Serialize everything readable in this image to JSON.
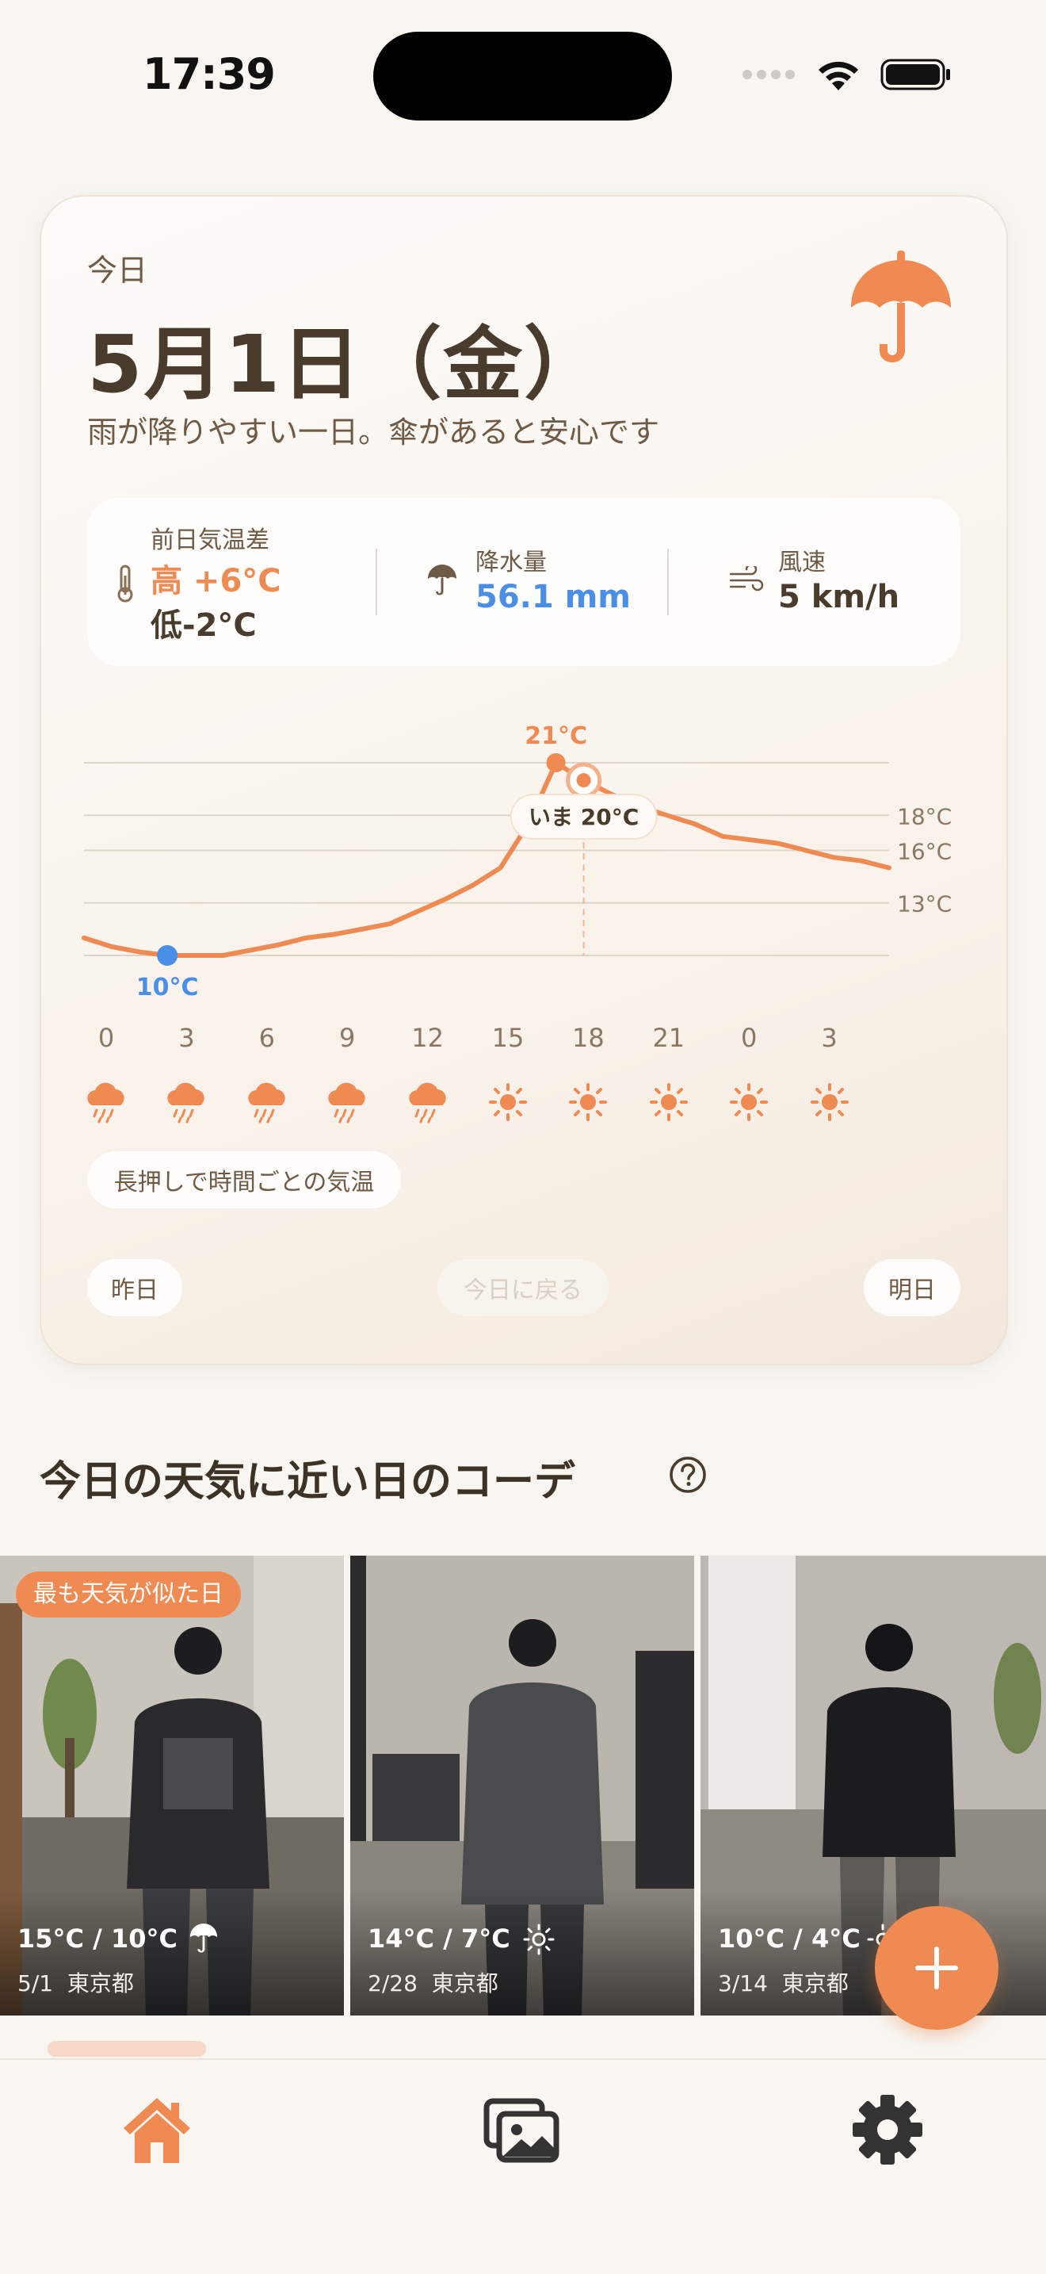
{
  "status_bar": {
    "time": "17:39"
  },
  "card": {
    "today_label": "今日",
    "date": "5月1日（金）",
    "description": "雨が降りやすい一日。傘があると安心です",
    "weather_icon": "umbrella-icon",
    "stats": {
      "diff_label": "前日気温差",
      "diff_high": "高 +6°C",
      "diff_low": "低-2°C",
      "precip_label": "降水量",
      "precip_value": "56.1 mm",
      "wind_label": "風速",
      "wind_value": "5 km/h"
    },
    "chart_data": {
      "type": "line",
      "x": [
        "0",
        "1",
        "2",
        "3",
        "4",
        "5",
        "6",
        "7",
        "8",
        "9",
        "10",
        "11",
        "12",
        "13",
        "14",
        "15",
        "16",
        "17",
        "18",
        "19",
        "20",
        "21",
        "22",
        "23",
        "0",
        "1",
        "2",
        "3",
        "4",
        "5"
      ],
      "values": [
        11,
        10.5,
        10.2,
        10,
        10,
        10,
        10.3,
        10.6,
        11,
        11.2,
        11.5,
        11.8,
        12.5,
        13.2,
        14,
        15,
        17.5,
        21,
        20,
        19.2,
        18.5,
        18,
        17.5,
        16.8,
        16.6,
        16.4,
        16,
        15.6,
        15.4,
        15
      ],
      "max_label": "21°C",
      "min_label": "10°C",
      "now_label": "いま 20°C",
      "gridline_labels": [
        "18°C",
        "16°C",
        "13°C"
      ],
      "hour_ticks": [
        "0",
        "3",
        "6",
        "9",
        "12",
        "15",
        "18",
        "21",
        "0",
        "3"
      ],
      "hour_icons": [
        "rain",
        "rain",
        "rain",
        "rain",
        "rain",
        "sun",
        "sun",
        "sun",
        "sun",
        "sun"
      ]
    },
    "hint": "長押しで時間ごとの気温",
    "nav": {
      "prev": "昨日",
      "back_today": "今日に戻る",
      "next": "明日"
    }
  },
  "outfits": {
    "title": "今日の天気に近い日のコーデ",
    "badge": "最も天気が似た日",
    "items": [
      {
        "temp": "15°C / 10°C",
        "icon": "umbrella",
        "date": "5/1",
        "place": "東京都"
      },
      {
        "temp": "14°C / 7°C",
        "icon": "sun",
        "date": "2/28",
        "place": "東京都"
      },
      {
        "temp": "10°C / 4°C",
        "icon": "sun",
        "date": "3/14",
        "place": "東京都"
      }
    ]
  },
  "colors": {
    "accent": "#ef8a52",
    "blue": "#4a8ee6",
    "text": "#4a3c2c",
    "background": "#f9f6f2"
  }
}
